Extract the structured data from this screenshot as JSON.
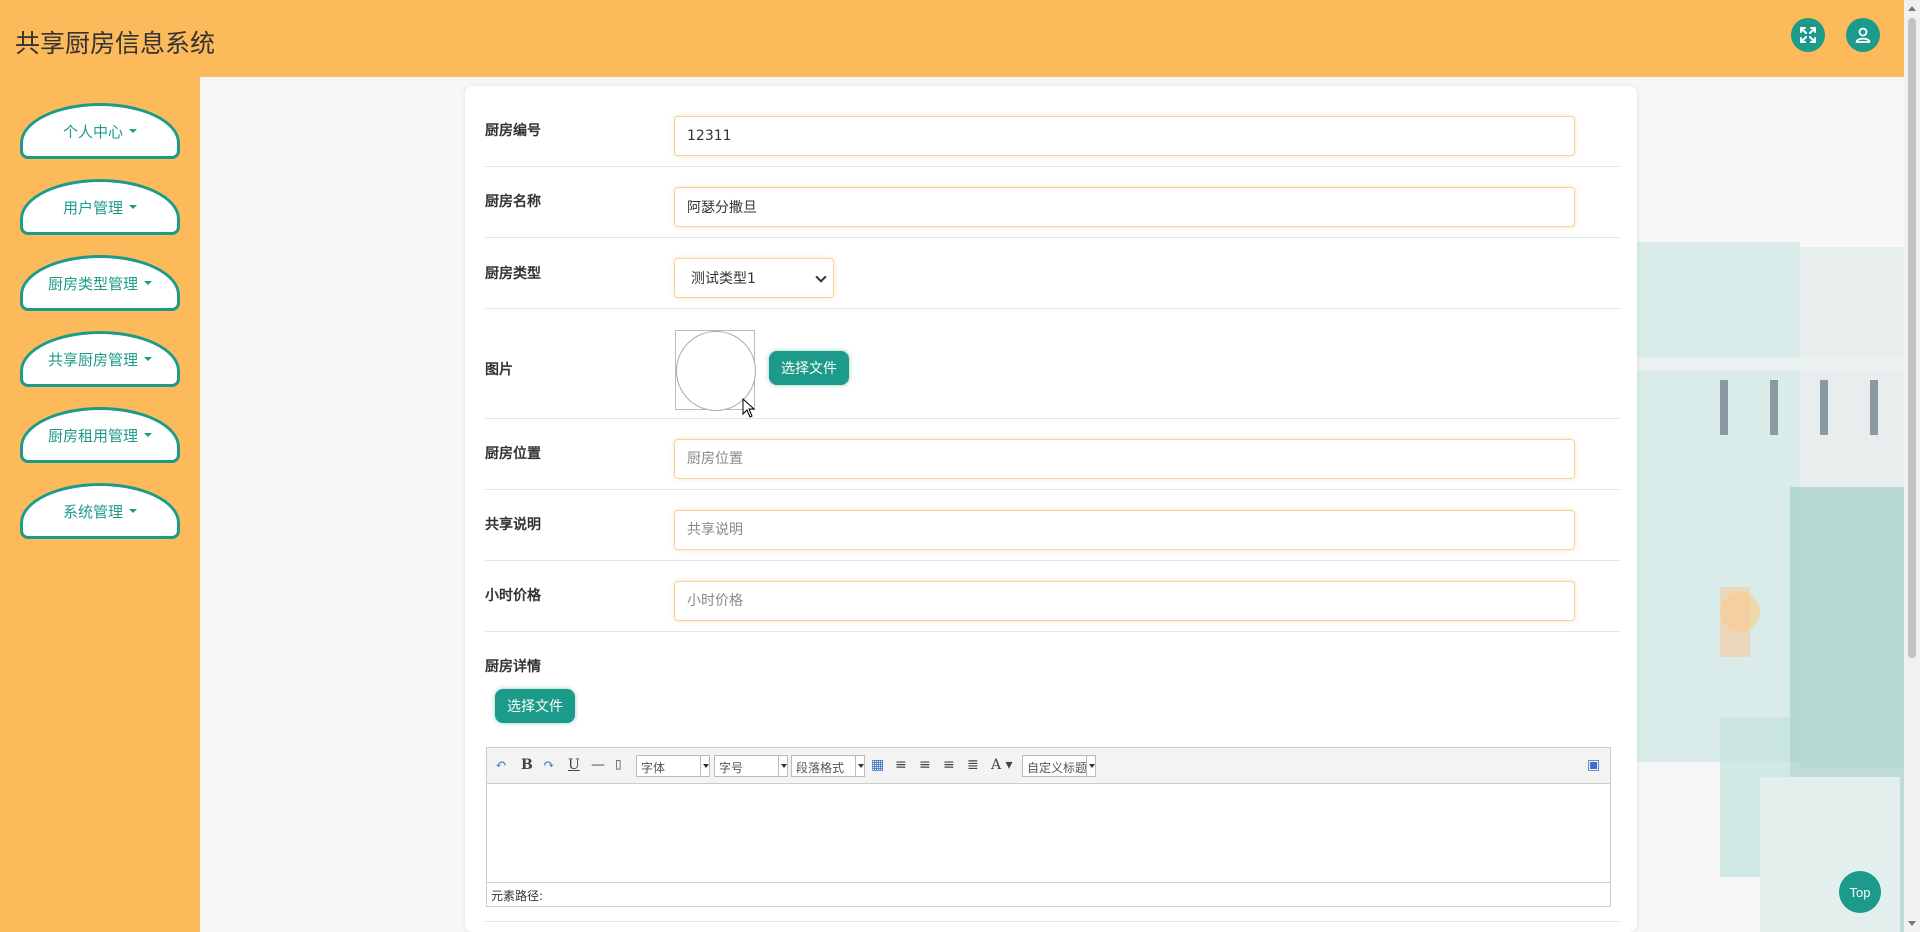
{
  "app": {
    "title": "共享厨房信息系统"
  },
  "header": {
    "fullscreen_icon": "expand-icon",
    "user_icon": "user-icon"
  },
  "sidebar": {
    "items": [
      {
        "label": "个人中心"
      },
      {
        "label": "用户管理"
      },
      {
        "label": "厨房类型管理"
      },
      {
        "label": "共享厨房管理"
      },
      {
        "label": "厨房租用管理"
      },
      {
        "label": "系统管理"
      }
    ]
  },
  "form": {
    "kitchen_no": {
      "label": "厨房编号",
      "value": "12311"
    },
    "kitchen_name": {
      "label": "厨房名称",
      "value": "阿瑟分撒旦"
    },
    "kitchen_type": {
      "label": "厨房类型",
      "selected": "测试类型1"
    },
    "image": {
      "label": "图片",
      "button": "选择文件"
    },
    "location": {
      "label": "厨房位置",
      "placeholder": "厨房位置"
    },
    "share_desc": {
      "label": "共享说明",
      "placeholder": "共享说明"
    },
    "hourly_price": {
      "label": "小时价格",
      "placeholder": "小时价格"
    },
    "details": {
      "label": "厨房详情",
      "button": "选择文件"
    }
  },
  "editor": {
    "font_combo": "字体",
    "size_combo": "字号",
    "paragraph_combo": "段落格式",
    "custom_title_combo": "自定义标题",
    "path_label": "元素路径:"
  },
  "top_button": {
    "label": "Top"
  },
  "colors": {
    "accent": "#1c9a8a",
    "header": "#fdba5b"
  }
}
